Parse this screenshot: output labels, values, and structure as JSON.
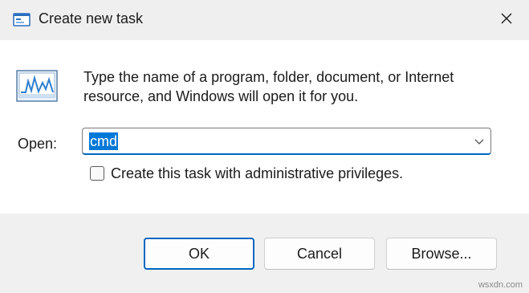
{
  "window": {
    "title": "Create new task",
    "title_icon": "run-dialog-icon",
    "close_icon": "close-icon"
  },
  "content": {
    "icon": "run-program-icon",
    "description": "Type the name of a program, folder, document, or Internet resource, and Windows will open it for you.",
    "open_label": "Open:",
    "open_value": "cmd",
    "dropdown_icon": "chevron-down-icon",
    "admin_checkbox_label": "Create this task with administrative privileges.",
    "admin_checked": false
  },
  "buttons": {
    "ok": "OK",
    "cancel": "Cancel",
    "browse": "Browse..."
  },
  "watermark": "wsxdn.com",
  "colors": {
    "accent": "#0067c0",
    "selection": "#0078d7"
  }
}
